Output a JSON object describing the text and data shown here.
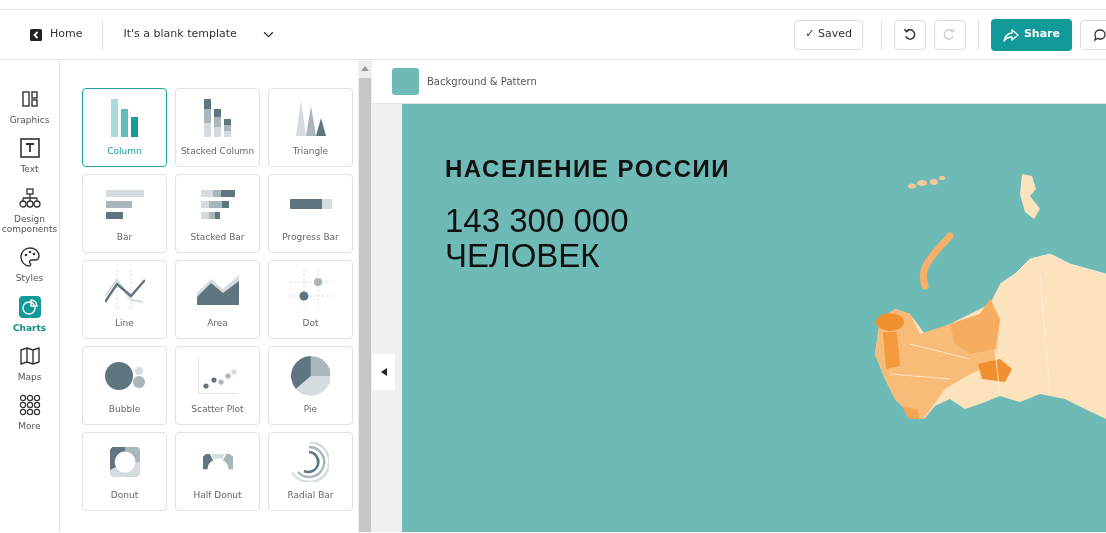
{
  "topbar": {
    "home": "Home",
    "template_title": "It's a blank template",
    "saved": "✓ Saved",
    "undo": {
      "disabled": false
    },
    "redo": {
      "disabled": true
    },
    "share": "Share"
  },
  "sidebar": {
    "items": [
      {
        "kind": "graphics",
        "label": "Graphics",
        "selected": false
      },
      {
        "kind": "text",
        "label": "Text",
        "selected": false
      },
      {
        "kind": "design",
        "label": "Design components",
        "selected": false
      },
      {
        "kind": "styles",
        "label": "Styles",
        "selected": false
      },
      {
        "kind": "charts",
        "label": "Charts",
        "selected": true
      },
      {
        "kind": "maps",
        "label": "Maps",
        "selected": false
      },
      {
        "kind": "more",
        "label": "More",
        "selected": false
      }
    ]
  },
  "charts_panel": {
    "tiles": [
      {
        "kind": "column",
        "label": "Column",
        "selected": true
      },
      {
        "kind": "stacked_column",
        "label": "Stacked Column",
        "selected": false
      },
      {
        "kind": "triangle",
        "label": "Triangle",
        "selected": false
      },
      {
        "kind": "bar",
        "label": "Bar",
        "selected": false
      },
      {
        "kind": "stacked_bar",
        "label": "Stacked Bar",
        "selected": false
      },
      {
        "kind": "progress_bar",
        "label": "Progress Bar",
        "selected": false
      },
      {
        "kind": "line",
        "label": "Line",
        "selected": false
      },
      {
        "kind": "area",
        "label": "Area",
        "selected": false
      },
      {
        "kind": "dot",
        "label": "Dot",
        "selected": false
      },
      {
        "kind": "bubble",
        "label": "Bubble",
        "selected": false
      },
      {
        "kind": "scatter",
        "label": "Scatter Plot",
        "selected": false
      },
      {
        "kind": "pie",
        "label": "Pie",
        "selected": false
      },
      {
        "kind": "donut",
        "label": "Donut",
        "selected": false
      },
      {
        "kind": "half_donut",
        "label": "Half Donut",
        "selected": false
      },
      {
        "kind": "radial_bar",
        "label": "Radial Bar",
        "selected": false
      }
    ]
  },
  "canvas_header": {
    "label": "Background & Pattern"
  },
  "canvas": {
    "title": "НАСЕЛЕНИЕ РОССИИ",
    "lines": [
      "143 300 000",
      "ЧЕЛОВЕК"
    ]
  }
}
